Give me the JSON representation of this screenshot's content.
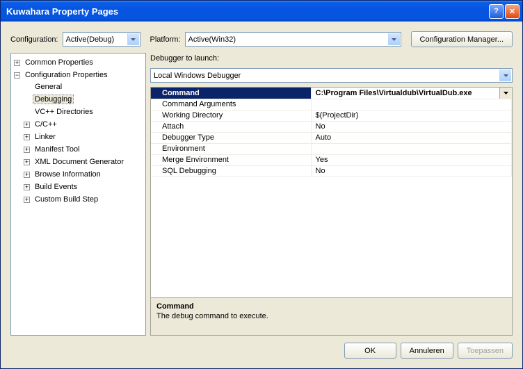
{
  "window": {
    "title": "Kuwahara Property Pages"
  },
  "toolbar": {
    "config_label": "Configuration:",
    "config_value": "Active(Debug)",
    "platform_label": "Platform:",
    "platform_value": "Active(Win32)",
    "config_mgr_label": "Configuration Manager..."
  },
  "tree": {
    "common": "Common Properties",
    "config": "Configuration Properties",
    "general": "General",
    "debugging": "Debugging",
    "vcdirs": "VC++ Directories",
    "cpp": "C/C++",
    "linker": "Linker",
    "manifest": "Manifest Tool",
    "xmldoc": "XML Document Generator",
    "browse": "Browse Information",
    "build": "Build Events",
    "custom": "Custom Build Step"
  },
  "launch": {
    "label": "Debugger to launch:",
    "value": "Local Windows Debugger"
  },
  "props": [
    {
      "name": "Command",
      "value": "C:\\Program Files\\Virtualdub\\VirtualDub.exe",
      "selected": true
    },
    {
      "name": "Command Arguments",
      "value": ""
    },
    {
      "name": "Working Directory",
      "value": "$(ProjectDir)"
    },
    {
      "name": "Attach",
      "value": "No"
    },
    {
      "name": "Debugger Type",
      "value": "Auto"
    },
    {
      "name": "Environment",
      "value": ""
    },
    {
      "name": "Merge Environment",
      "value": "Yes"
    },
    {
      "name": "SQL Debugging",
      "value": "No"
    }
  ],
  "desc": {
    "title": "Command",
    "text": "The debug command to execute."
  },
  "buttons": {
    "ok": "OK",
    "cancel": "Annuleren",
    "apply": "Toepassen"
  }
}
